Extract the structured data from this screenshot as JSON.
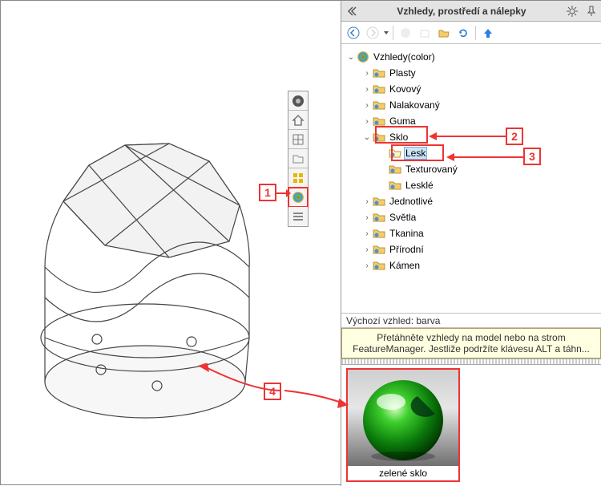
{
  "panel": {
    "title": "Vzhledy, prostředí a nálepky"
  },
  "callouts": {
    "c1": "1",
    "c2": "2",
    "c3": "3",
    "c4": "4"
  },
  "tree": {
    "root": "Vzhledy(color)",
    "plasty": "Plasty",
    "kovovy": "Kovový",
    "nalakovany": "Nalakovaný",
    "guma": "Guma",
    "sklo": "Sklo",
    "lesk": "Lesk",
    "texturovany": "Texturovaný",
    "leskle": "Lesklé",
    "jednotlive": "Jednotlivé",
    "svetla": "Světla",
    "tkanina": "Tkanina",
    "prirodni": "Přírodní",
    "kamen": "Kámen"
  },
  "default_line": "Výchozí vzhled: barva",
  "hint": "Přetáhněte vzhledy na model nebo na strom FeatureManager. Jestliže podržíte klávesu ALT a táhn...",
  "preview": {
    "label": "zelené sklo"
  }
}
